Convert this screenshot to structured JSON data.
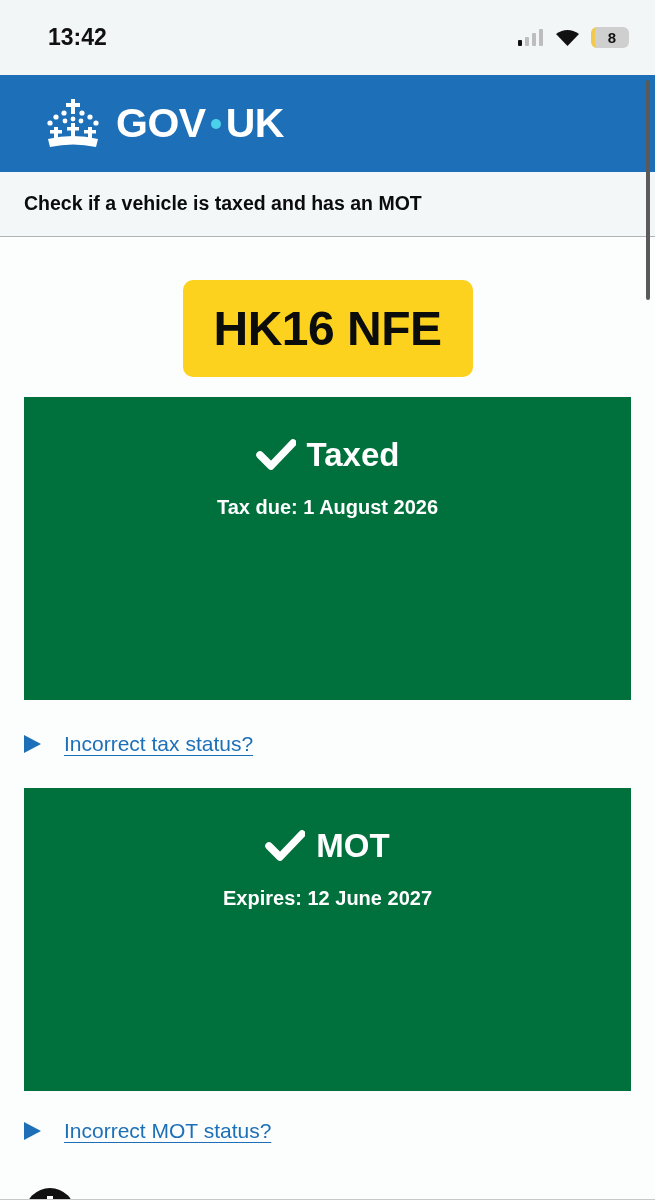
{
  "status_bar": {
    "time": "13:42",
    "battery": "8"
  },
  "header": {
    "logo": [
      "GOV",
      "UK"
    ]
  },
  "service_name": "Check if a vehicle is taxed and has an MOT",
  "registration": "HK16 NFE",
  "statuses": [
    {
      "title": "Taxed",
      "detail": "Tax due: 1 August 2026",
      "link": "Incorrect tax status?",
      "expanded": false
    },
    {
      "title": "MOT",
      "detail": "Expires: 12 June 2027",
      "link": "Incorrect MOT status?",
      "expanded": false
    }
  ]
}
